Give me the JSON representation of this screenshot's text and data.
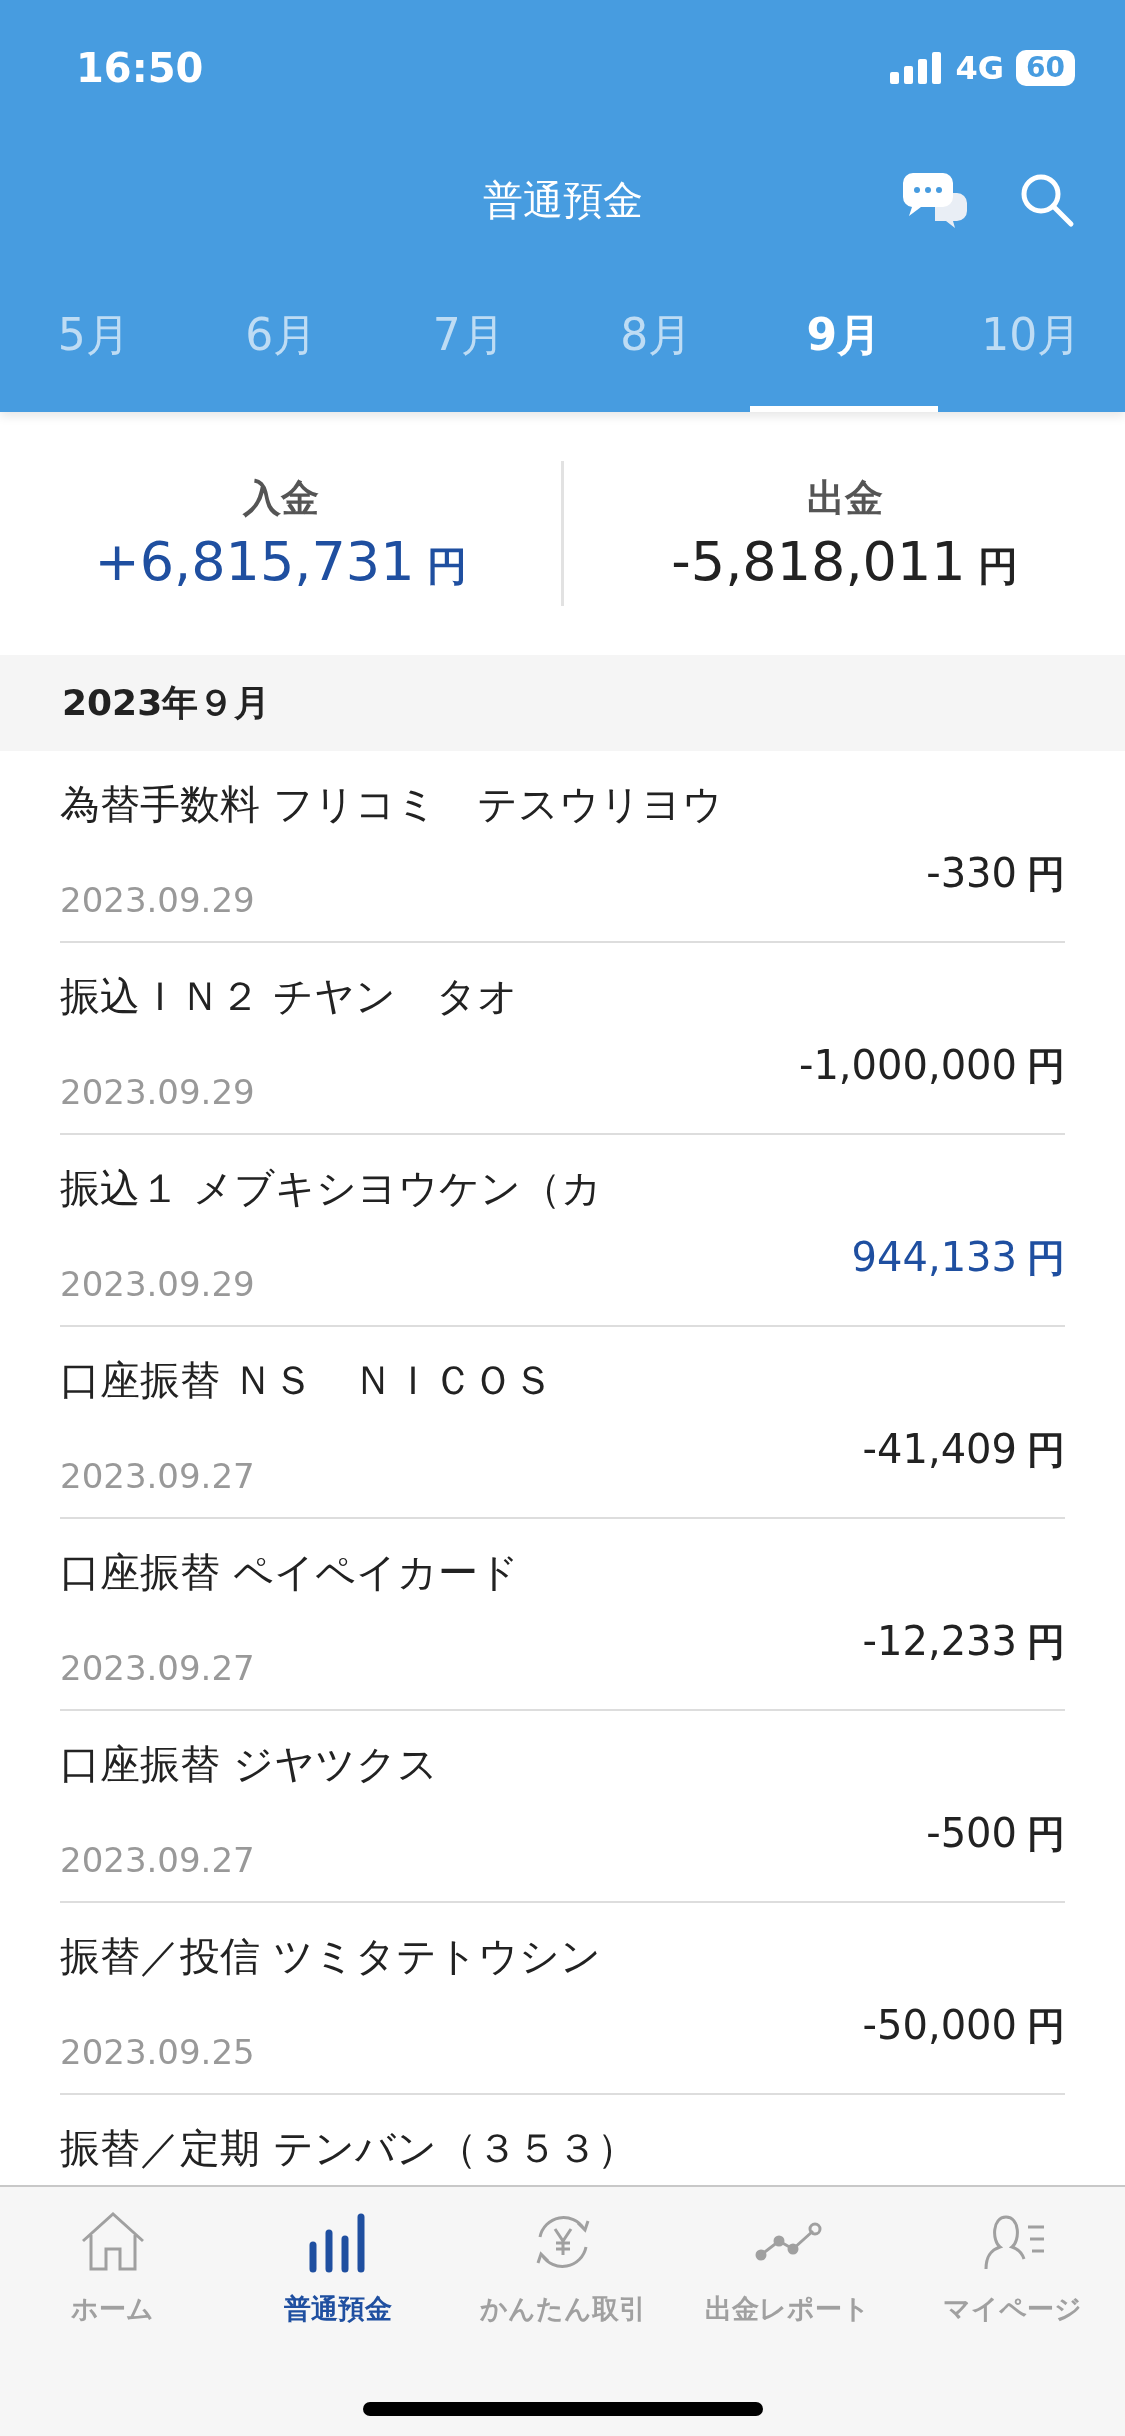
{
  "status_bar": {
    "time": "16:50",
    "network": "4G",
    "battery": "60"
  },
  "header": {
    "title": "普通預金"
  },
  "tabs": [
    {
      "label": "5月",
      "selected": false
    },
    {
      "label": "6月",
      "selected": false
    },
    {
      "label": "7月",
      "selected": false
    },
    {
      "label": "8月",
      "selected": false
    },
    {
      "label": "9月",
      "selected": true
    },
    {
      "label": "10月",
      "selected": false
    }
  ],
  "summary": [
    {
      "label": "入金",
      "amount": "+6,815,731",
      "unit": "円",
      "kind": "in"
    },
    {
      "label": "出金",
      "amount": "-5,818,011",
      "unit": "円",
      "kind": "out"
    }
  ],
  "section": {
    "title": "2023年９月"
  },
  "transactions": [
    {
      "description": "為替手数料 フリコミ　テスウリヨウ",
      "date": "2023.09.29",
      "amount": "-330",
      "unit": "円",
      "kind": "out"
    },
    {
      "description": "振込ＩＮ２ チヤン　タオ",
      "date": "2023.09.29",
      "amount": "-1,000,000",
      "unit": "円",
      "kind": "out"
    },
    {
      "description": "振込１ メブキシヨウケン（カ",
      "date": "2023.09.29",
      "amount": "944,133",
      "unit": "円",
      "kind": "in"
    },
    {
      "description": "口座振替 ＮＳ　ＮＩＣＯＳ",
      "date": "2023.09.27",
      "amount": "-41,409",
      "unit": "円",
      "kind": "out"
    },
    {
      "description": "口座振替 ペイペイカード",
      "date": "2023.09.27",
      "amount": "-12,233",
      "unit": "円",
      "kind": "out"
    },
    {
      "description": "口座振替 ジヤツクス",
      "date": "2023.09.27",
      "amount": "-500",
      "unit": "円",
      "kind": "out"
    },
    {
      "description": "振替／投信 ツミタテトウシン",
      "date": "2023.09.25",
      "amount": "-50,000",
      "unit": "円",
      "kind": "out"
    },
    {
      "description": "振替／定期 テンバン（３５３）"
    }
  ],
  "nav": [
    {
      "label": "ホーム",
      "kind": "home",
      "selected": false
    },
    {
      "label": "普通預金",
      "kind": "bars",
      "selected": true
    },
    {
      "label": "かんたん取引",
      "kind": "exchange",
      "selected": false
    },
    {
      "label": "出金レポート",
      "kind": "report",
      "selected": false
    },
    {
      "label": "マイページ",
      "kind": "person",
      "selected": false
    }
  ]
}
